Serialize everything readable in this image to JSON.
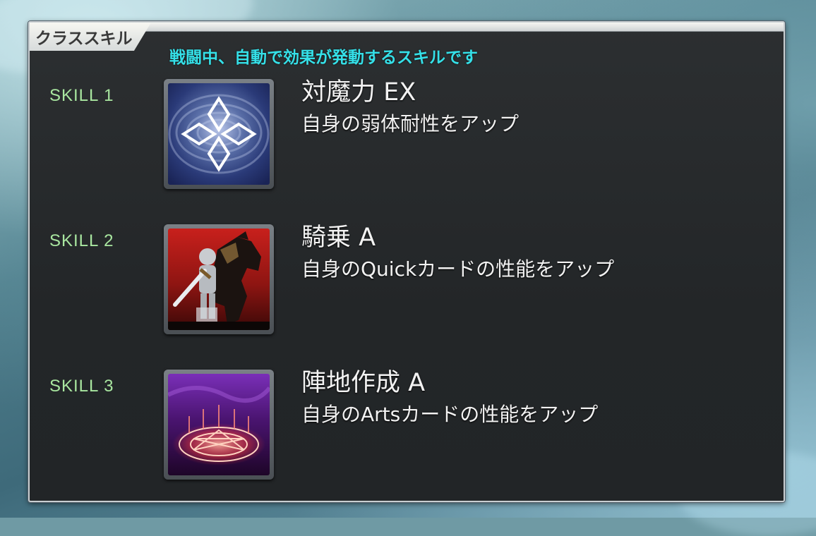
{
  "panel": {
    "tab_title": "クラススキル",
    "subtitle": "戦闘中、自動で効果が発動するスキルです"
  },
  "skills": [
    {
      "slot_label": "SKILL 1",
      "name": "対魔力 EX",
      "description": "自身の弱体耐性をアップ",
      "icon": "magic-resistance-icon"
    },
    {
      "slot_label": "SKILL 2",
      "name": "騎乗 A",
      "description": "自身のQuickカードの性能をアップ",
      "icon": "riding-icon"
    },
    {
      "slot_label": "SKILL 3",
      "name": "陣地作成 A",
      "description": "自身のArtsカードの性能をアップ",
      "icon": "territory-creation-icon"
    }
  ],
  "colors": {
    "subtitle": "#35e0e8",
    "skill_label": "#a9e7a0",
    "text": "#f2f2f2",
    "panel_bg": "#26292b"
  }
}
